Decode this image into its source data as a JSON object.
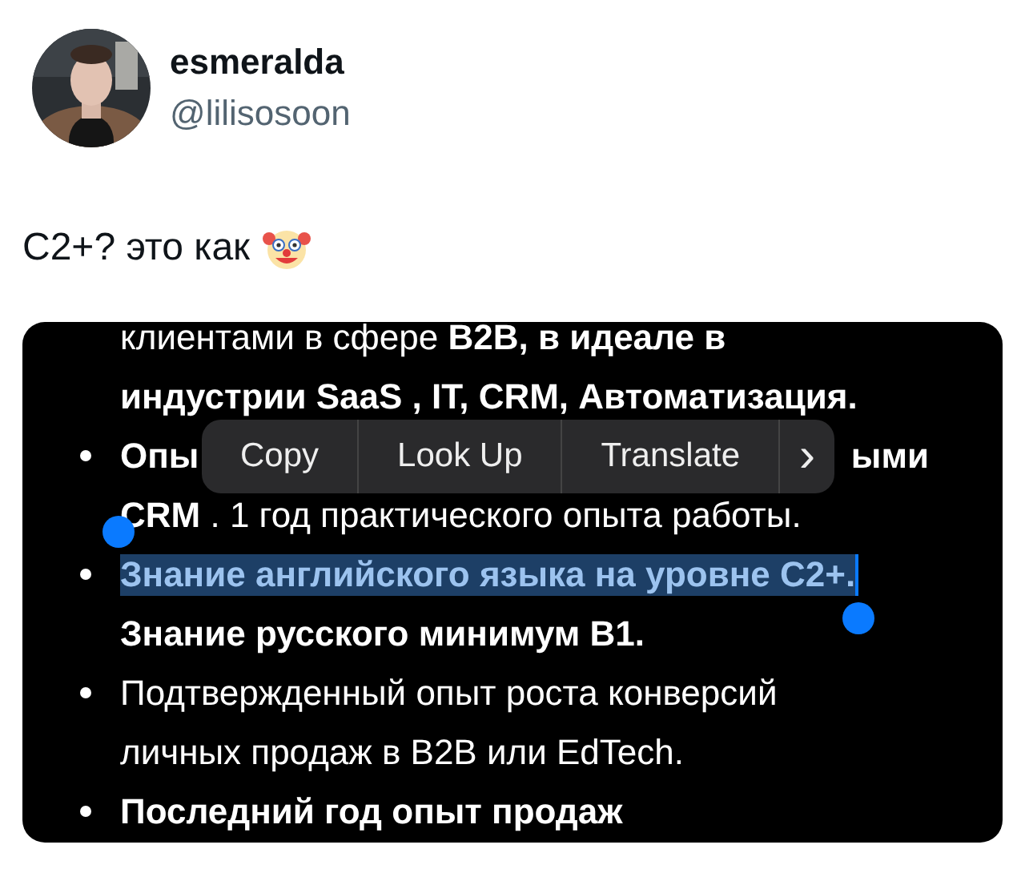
{
  "author": {
    "name": "esmeralda",
    "handle": "@lilisosoon"
  },
  "tweet": {
    "text": "C2+? это как"
  },
  "attached_image": {
    "lines": [
      {
        "kind": "text",
        "bullet": false,
        "bold": false,
        "selected": false,
        "text": "клиентами в сфере **B2B, в идеале в**"
      },
      {
        "kind": "text",
        "bullet": false,
        "bold": true,
        "selected": false,
        "text": "индустрии SaaS , IT, CRM, Автоматизация."
      },
      {
        "kind": "split",
        "bullet": true,
        "bold": true,
        "selected": false,
        "left": "Опы",
        "right": "ыми"
      },
      {
        "kind": "text",
        "bullet": false,
        "bold": false,
        "selected": false,
        "text": "**CRM** . 1 год практического опыта работы."
      },
      {
        "kind": "text",
        "bullet": true,
        "bold": true,
        "selected": true,
        "text": "Знание английского языка на уровне C2+."
      },
      {
        "kind": "text",
        "bullet": false,
        "bold": true,
        "selected": false,
        "text": "Знание русского минимум B1."
      },
      {
        "kind": "text",
        "bullet": true,
        "bold": false,
        "selected": false,
        "text": "Подтвержденный опыт роста конверсий"
      },
      {
        "kind": "text",
        "bullet": false,
        "bold": false,
        "selected": false,
        "text": "личных продаж в B2B или EdTech."
      },
      {
        "kind": "text",
        "bullet": true,
        "bold": true,
        "selected": false,
        "text": "Последний год опыт продаж"
      }
    ],
    "context_menu": {
      "items": [
        "Copy",
        "Look Up",
        "Translate"
      ],
      "more": "›"
    }
  }
}
